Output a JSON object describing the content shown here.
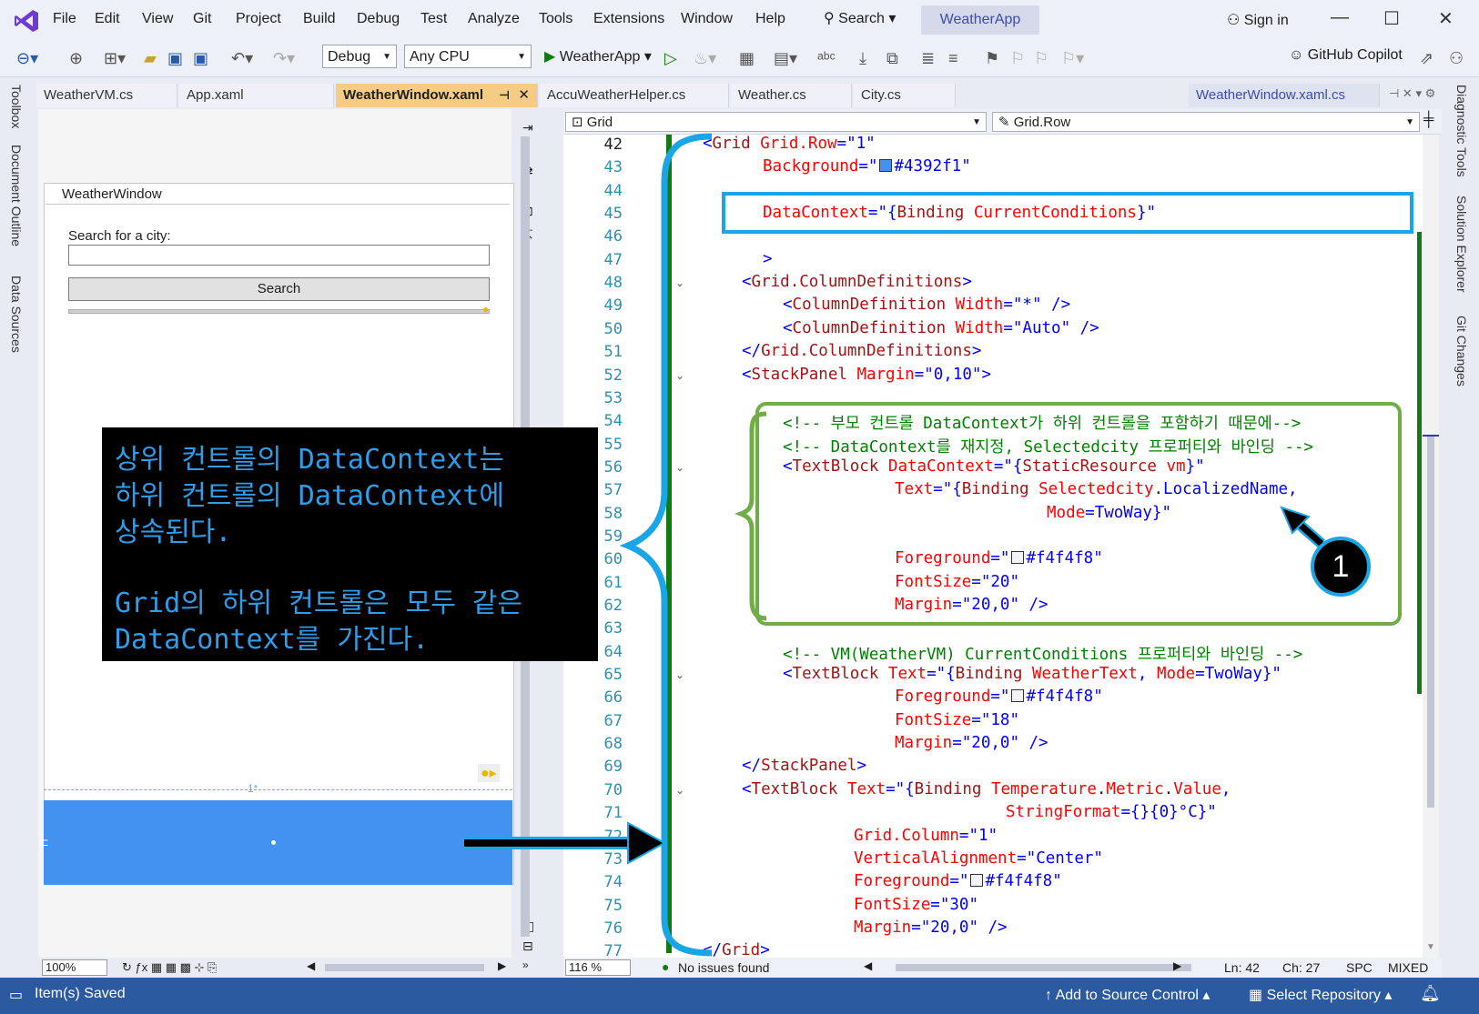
{
  "menu": {
    "items": [
      "File",
      "Edit",
      "View",
      "Git",
      "Project",
      "Build",
      "Debug",
      "Test",
      "Analyze",
      "Tools",
      "Extensions",
      "Window",
      "Help"
    ],
    "search_label": "Search",
    "app_name": "WeatherApp",
    "sign_in": "Sign in"
  },
  "toolbar": {
    "config": "Debug",
    "platform": "Any CPU",
    "run_target": "WeatherApp",
    "copilot": "GitHub Copilot"
  },
  "left_tabs": [
    "Toolbox",
    "Document Outline",
    "Data Sources"
  ],
  "right_tabs": [
    "Diagnostic Tools",
    "Solution Explorer",
    "Git Changes"
  ],
  "tabs": [
    {
      "label": "WeatherVM.cs",
      "active": false
    },
    {
      "label": "App.xaml",
      "active": false
    },
    {
      "label": "WeatherWindow.xaml",
      "active": true
    },
    {
      "label": "AccuWeatherHelper.cs",
      "active": false
    },
    {
      "label": "Weather.cs",
      "active": false
    },
    {
      "label": "City.cs",
      "active": false
    }
  ],
  "preview_tab": "WeatherWindow.xaml.cs",
  "designer": {
    "window_title": "WeatherWindow",
    "search_label": "Search for a city:",
    "search_button": "Search",
    "row_marker": "1*",
    "zoom": "100%"
  },
  "nav": {
    "left": "Grid",
    "right": "Grid.Row"
  },
  "editor": {
    "zoom": "116 %",
    "issues": "No issues found",
    "line": "Ln: 42",
    "col": "Ch: 27",
    "whitespace": "SPC",
    "line_endings": "MIXED",
    "line_numbers": [
      "42",
      "43",
      "44",
      "45",
      "46",
      "47",
      "48",
      "49",
      "50",
      "51",
      "52",
      "53",
      "54",
      "55",
      "56",
      "57",
      "58",
      "59",
      "60",
      "61",
      "62",
      "63",
      "64",
      "65",
      "66",
      "67",
      "68",
      "69",
      "70",
      "71",
      "72",
      "73",
      "74",
      "75",
      "76",
      "77"
    ]
  },
  "code": {
    "l42": [
      "<",
      "Grid",
      " Grid.Row",
      "=\"",
      "1",
      "\""
    ],
    "l43": [
      "Background",
      "=\"",
      "#4392f1",
      "\""
    ],
    "l45": [
      "DataContext",
      "=\"{",
      "Binding",
      " CurrentConditions",
      "}\""
    ],
    "l47": [
      ">"
    ],
    "l48": [
      "<",
      "Grid.ColumnDefinitions",
      ">"
    ],
    "l49": [
      "<",
      "ColumnDefinition",
      " Width",
      "=\"",
      "*",
      "\" />"
    ],
    "l50": [
      "<",
      "ColumnDefinition",
      " Width",
      "=\"",
      "Auto",
      "\" />"
    ],
    "l51": [
      "</",
      "Grid.ColumnDefinitions",
      ">"
    ],
    "l52": [
      "<",
      "StackPanel",
      " Margin",
      "=\"",
      "0,10",
      "\">"
    ],
    "l54": "<!-- 부모 컨트롤 DataContext가 하위 컨트롤을 포함하기 때문에-->",
    "l55": "<!-- DataContext를 재지정, Selectedcity 프로퍼티와 바인딩 -->",
    "l56": [
      "<",
      "TextBlock",
      " DataContext",
      "=\"{",
      "StaticResource",
      " vm",
      "}\""
    ],
    "l57": [
      "Text",
      "=\"{",
      "Binding",
      " Selectedcity",
      ".",
      "LocalizedName",
      ","
    ],
    "l58": [
      "Mode",
      "=",
      "TwoWay",
      "}\""
    ],
    "l60": [
      "Foreground",
      "=\"",
      "#f4f4f8",
      "\""
    ],
    "l61": [
      "FontSize",
      "=\"",
      "20",
      "\""
    ],
    "l62": [
      "Margin",
      "=\"",
      "20,0",
      "\" />"
    ],
    "l64": "<!-- VM(WeatherVM) CurrentConditions 프로퍼티와 바인딩 -->",
    "l65": [
      "<",
      "TextBlock",
      " Text",
      "=\"{",
      "Binding",
      " WeatherText",
      ", ",
      "Mode",
      "=",
      "TwoWay",
      "}\""
    ],
    "l66": [
      "Foreground",
      "=\"",
      "#f4f4f8",
      "\""
    ],
    "l67": [
      "FontSize",
      "=\"",
      "18",
      "\""
    ],
    "l68": [
      "Margin",
      "=\"",
      "20,0",
      "\" />"
    ],
    "l69": [
      "</",
      "StackPanel",
      ">"
    ],
    "l70": [
      "<",
      "TextBlock",
      " Text",
      "=\"{",
      "Binding",
      " Temperature",
      ".",
      "Metric",
      ".",
      "Value",
      ","
    ],
    "l71": [
      "StringFormat",
      "={}{0}°C}\""
    ],
    "l72": [
      "Grid.Column",
      "=\"",
      "1",
      "\""
    ],
    "l73": [
      "VerticalAlignment",
      "=\"",
      "Center",
      "\""
    ],
    "l74": [
      "Foreground",
      "=\"",
      "#f4f4f8",
      "\""
    ],
    "l75": [
      "FontSize",
      "=\"",
      "30",
      "\""
    ],
    "l76": [
      "Margin",
      "=\"",
      "20,0",
      "\" />"
    ],
    "l77": [
      "</",
      "Grid",
      ">"
    ]
  },
  "annotation": {
    "lines": [
      "상위 컨트롤의 DataContext는",
      "하위 컨트롤의 DataContext에",
      "상속된다.",
      "",
      "Grid의 하위 컨트롤은 모두 같은",
      "DataContext를 가진다."
    ],
    "badge": "1"
  },
  "status": {
    "saved": "Item(s) Saved",
    "source_control": "Add to Source Control",
    "repo": "Select Repository"
  },
  "colors": {
    "grid_background": "#4392f1",
    "foreground": "#f4f4f8",
    "status_bar": "#2b5aa0",
    "annotation_blue": "#1aa6e6",
    "annotation_green": "#70ad47"
  }
}
